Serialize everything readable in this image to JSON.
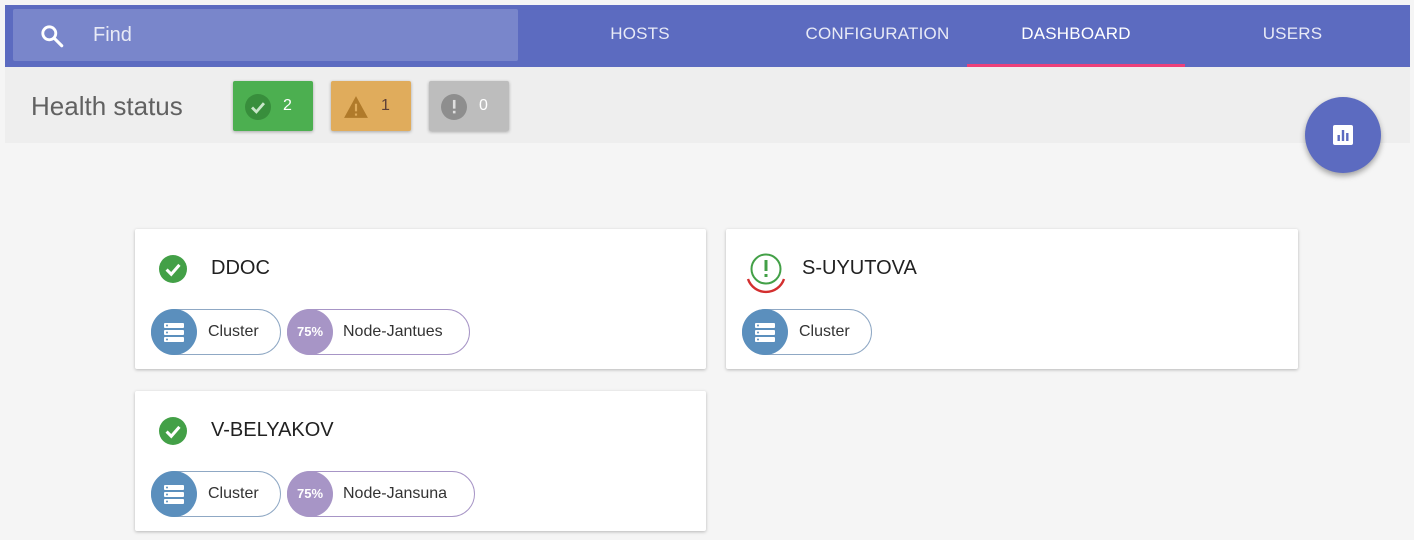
{
  "search": {
    "placeholder": "Find"
  },
  "tabs": [
    {
      "label": "HOSTS"
    },
    {
      "label": "CONFIGURATION"
    },
    {
      "label": "DASHBOARD",
      "active": true
    },
    {
      "label": "USERS"
    }
  ],
  "health": {
    "title": "Health status",
    "ok": {
      "count": "2",
      "color": "#4caf50"
    },
    "warning": {
      "count": "1",
      "color": "#e0ac5c"
    },
    "unknown": {
      "count": "0",
      "color": "#bdbdbd"
    }
  },
  "colors": {
    "primary": "#5c6bc0",
    "accent": "#ec407a",
    "ok": "#43a047",
    "error": "#d32f2f"
  },
  "hosts": [
    {
      "name": "DDOC",
      "status": "ok",
      "chips": [
        {
          "type": "cluster",
          "label": "Cluster"
        },
        {
          "type": "node",
          "percent": "75%",
          "label": "Node-Jantues"
        }
      ]
    },
    {
      "name": "S-UYUTOVA",
      "status": "warning",
      "chips": [
        {
          "type": "cluster",
          "label": "Cluster"
        }
      ]
    },
    {
      "name": "V-BELYAKOV",
      "status": "ok",
      "chips": [
        {
          "type": "cluster",
          "label": "Cluster"
        },
        {
          "type": "node",
          "percent": "75%",
          "label": "Node-Jansuna"
        }
      ]
    }
  ]
}
